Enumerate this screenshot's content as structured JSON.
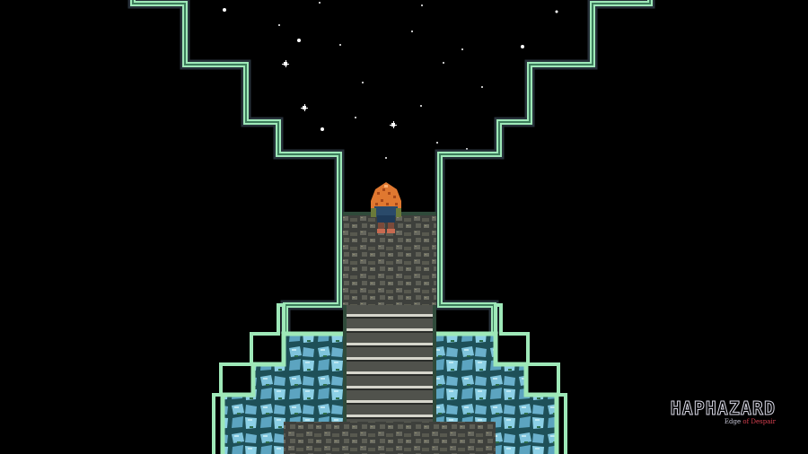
{
  "game": {
    "scene": "starry-summit",
    "player_facing": "north"
  },
  "watermark": {
    "title": "HAPHAZARD",
    "subtitle_prefix": "Edge ",
    "subtitle_mid": "of",
    "subtitle_suffix": " Despair"
  },
  "colors": {
    "background": "#000000",
    "wall_edge": "#9ee8b8",
    "wall_edge_dark": "#3a7a5a",
    "floor": "#4a4c48",
    "ice": "#7fc8e0",
    "hair": "#e07830"
  }
}
